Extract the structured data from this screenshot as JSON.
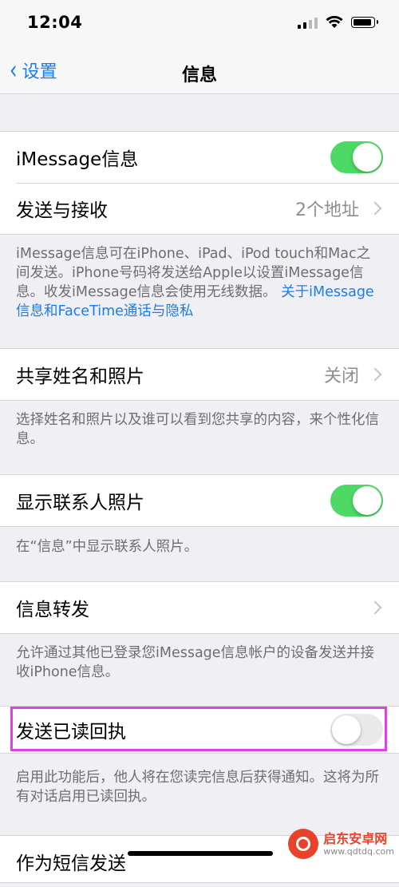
{
  "status": {
    "time": "12:04"
  },
  "nav": {
    "back_label": "设置",
    "title": "信息"
  },
  "rows": {
    "imessage": {
      "label": "iMessage信息",
      "on": true
    },
    "send_receive": {
      "label": "发送与接收",
      "value": "2个地址"
    },
    "share_name": {
      "label": "共享姓名和照片",
      "value": "关闭"
    },
    "show_contact_photos": {
      "label": "显示联系人照片",
      "on": true
    },
    "text_forwarding": {
      "label": "信息转发"
    },
    "read_receipts": {
      "label": "发送已读回执",
      "on": false
    },
    "send_as_sms": {
      "label": "作为短信发送"
    }
  },
  "footnotes": {
    "imessage_text": "iMessage信息可在iPhone、iPad、iPod touch和Mac之间发送。iPhone号码将发送给Apple以设置iMessage信息。收发iMessage信息会使用无线数据。",
    "imessage_link": "关于iMessage信息和FaceTime通话与隐私",
    "share_name": "选择姓名和照片以及谁可以看到您共享的内容，来个性化信息。",
    "contact_photos": "在“信息”中显示联系人照片。",
    "forwarding": "允许通过其他已登录您iMessage信息帐户的设备发送并接收iPhone信息。",
    "read_receipts": "启用此功能后，他人将在您读完信息后获得通知。这将为所有对话启用已读回执。"
  },
  "colors": {
    "accent": "#1a7cf4",
    "toggle_on": "#4cd964",
    "highlight": "#e040e8"
  },
  "watermark": {
    "title": "启东安卓网",
    "url": "www.qdtdq.com"
  }
}
